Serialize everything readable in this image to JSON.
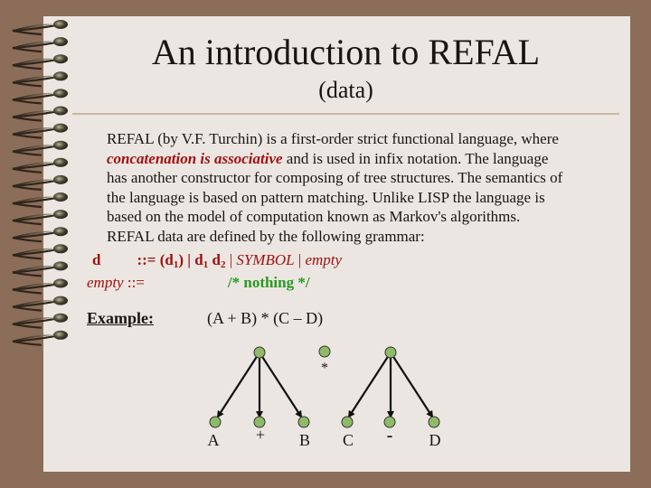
{
  "slide": {
    "title": "An introduction to REFAL",
    "subtitle": "(data)",
    "paragraph": {
      "line1": "REFAL (by V.F. Turchin) is a first-order strict functional language,  where",
      "line2_highlight": "concatenation  is  associative",
      "line2_rest": " and is used in infix notation. The language",
      "line3": "has another constructor for composing of tree structures. The semantics of",
      "line4": "the language is based on pattern matching. Unlike LISP the language is",
      "line5": "based on the model of computation known as Markov's algorithms.",
      "line6": "REFAL data are defined by the following grammar:"
    },
    "grammar": {
      "rule1": {
        "lhs": "d",
        "assign": "::= ",
        "part1": "(d",
        "sub1": "1",
        "part2": ") | d",
        "sub2": "1",
        "part3": " d",
        "sub3": "2",
        "part4": " | ",
        "symbol": "SYMBOL",
        "sep": " | ",
        "empty": "empty"
      },
      "rule2": {
        "lhs": "empty",
        "assign": " ::=",
        "comment": "/* nothing */"
      }
    },
    "example": {
      "label": "Example:",
      "expression": "(A + B) * (C – D)"
    },
    "tree": {
      "root_label": "*",
      "left_leaves": [
        "A",
        "+",
        "B"
      ],
      "right_leaves": [
        "C",
        "-",
        "D"
      ],
      "node_color": "#8fba68"
    },
    "colors": {
      "background": "#8c6d5a",
      "page": "#ebe6e1",
      "highlight": "#a01010",
      "comment": "#2a9a22"
    }
  }
}
